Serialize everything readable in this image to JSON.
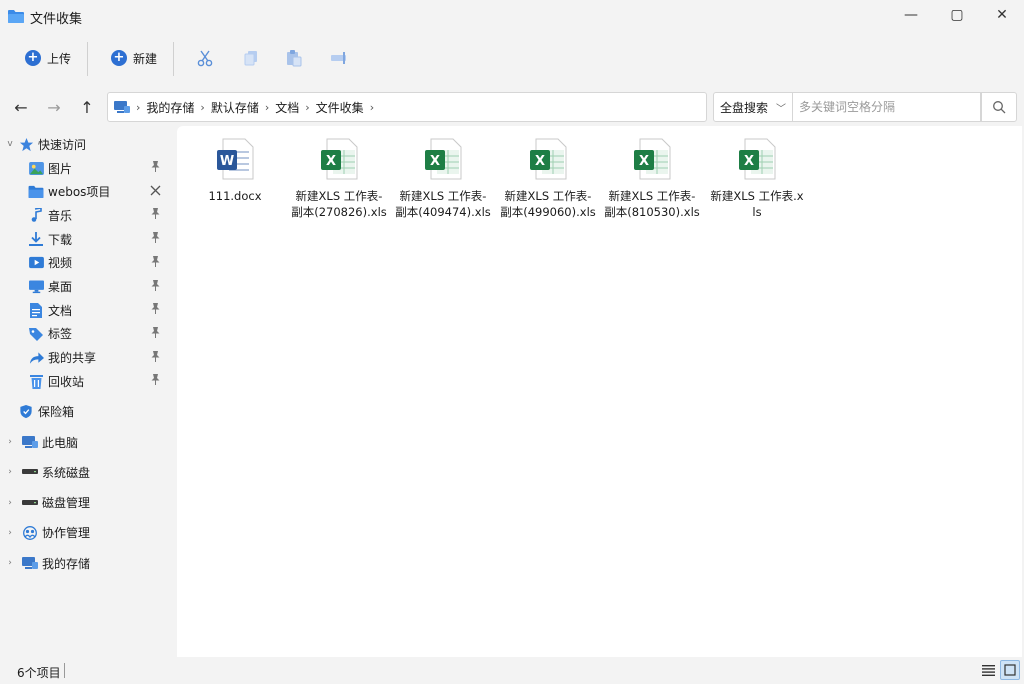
{
  "window": {
    "title": "文件收集",
    "minimize": "—",
    "maximize": "▢",
    "close": "✕"
  },
  "toolbar": {
    "upload_label": "上传",
    "new_label": "新建",
    "icons": [
      "cut-icon",
      "copy-icon",
      "paste-icon",
      "rename-icon"
    ]
  },
  "nav": {
    "back": "←",
    "forward": "→",
    "up": "↑",
    "breadcrumb": [
      "我的存储",
      "默认存储",
      "文档",
      "文件收集"
    ],
    "search_scope": "全盘搜索",
    "search_placeholder": "多关键词空格分隔"
  },
  "sidebar": {
    "quick_access": "快速访问",
    "pinned": [
      {
        "label": "图片",
        "icon": "pictures-icon",
        "pin": "pin"
      },
      {
        "label": "webos项目",
        "icon": "folder-icon",
        "pin": "unpin"
      },
      {
        "label": "音乐",
        "icon": "music-icon",
        "pin": "pin"
      },
      {
        "label": "下载",
        "icon": "download-icon",
        "pin": "pin"
      },
      {
        "label": "视频",
        "icon": "video-icon",
        "pin": "pin"
      },
      {
        "label": "桌面",
        "icon": "desktop-icon",
        "pin": "pin"
      },
      {
        "label": "文档",
        "icon": "document-icon",
        "pin": "pin"
      },
      {
        "label": "标签",
        "icon": "tag-icon",
        "pin": "pin"
      },
      {
        "label": "我的共享",
        "icon": "share-icon",
        "pin": "pin"
      },
      {
        "label": "回收站",
        "icon": "recycle-bin-icon",
        "pin": "pin"
      }
    ],
    "vault": "保险箱",
    "roots": [
      {
        "label": "此电脑",
        "icon": "computer-icon"
      },
      {
        "label": "系统磁盘",
        "icon": "disk-icon"
      },
      {
        "label": "磁盘管理",
        "icon": "disk-icon"
      },
      {
        "label": "协作管理",
        "icon": "collab-icon"
      },
      {
        "label": "我的存储",
        "icon": "storage-icon"
      }
    ]
  },
  "files": [
    {
      "name": "111.docx",
      "type": "word"
    },
    {
      "name": "新建XLS 工作表-副本(270826).xls",
      "type": "excel"
    },
    {
      "name": "新建XLS 工作表-副本(409474).xls",
      "type": "excel"
    },
    {
      "name": "新建XLS 工作表-副本(499060).xls",
      "type": "excel"
    },
    {
      "name": "新建XLS 工作表-副本(810530).xls",
      "type": "excel"
    },
    {
      "name": "新建XLS 工作表.xls",
      "type": "excel"
    }
  ],
  "status": {
    "item_count": "6个项目"
  },
  "colors": {
    "accent": "#2d6fd2",
    "excel": "#1e7e45",
    "word": "#2b579a"
  }
}
